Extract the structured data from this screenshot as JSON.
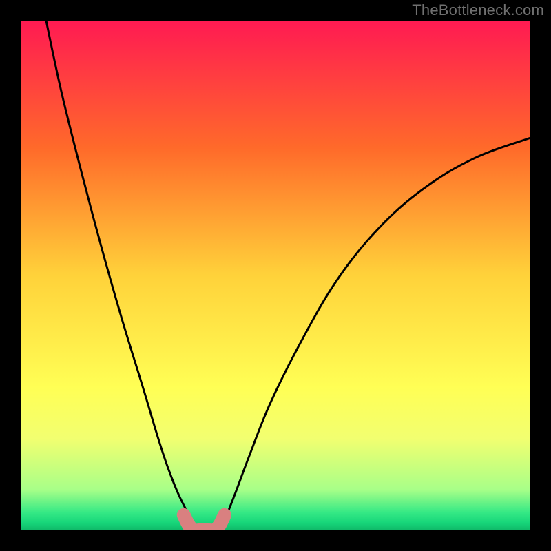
{
  "watermark": "TheBottleneck.com",
  "chart_data": {
    "type": "line",
    "title": "",
    "xlabel": "",
    "ylabel": "",
    "xlim": [
      0,
      100
    ],
    "ylim": [
      0,
      100
    ],
    "grid": false,
    "legend": false,
    "background_gradient": {
      "stops": [
        {
          "offset": 0.0,
          "color": "#ff1a52"
        },
        {
          "offset": 0.25,
          "color": "#ff6a2a"
        },
        {
          "offset": 0.5,
          "color": "#ffd23a"
        },
        {
          "offset": 0.72,
          "color": "#ffff55"
        },
        {
          "offset": 0.82,
          "color": "#f2ff70"
        },
        {
          "offset": 0.92,
          "color": "#a8ff88"
        },
        {
          "offset": 0.965,
          "color": "#35e985"
        },
        {
          "offset": 0.985,
          "color": "#17d67a"
        },
        {
          "offset": 1.0,
          "color": "#0fb868"
        }
      ]
    },
    "series": [
      {
        "name": "left-curve",
        "x": [
          5,
          8,
          12,
          16,
          20,
          24,
          27,
          29,
          31,
          33,
          34,
          35
        ],
        "y": [
          100,
          86,
          70,
          55,
          41,
          28,
          18,
          12,
          7,
          3,
          1,
          0
        ]
      },
      {
        "name": "right-curve",
        "x": [
          39,
          40,
          42,
          45,
          49,
          55,
          62,
          70,
          79,
          89,
          100
        ],
        "y": [
          0,
          2,
          7,
          15,
          25,
          37,
          49,
          59,
          67,
          73,
          77
        ]
      },
      {
        "name": "valley-marker",
        "x": [
          32,
          33,
          34,
          35,
          36,
          37,
          38,
          39,
          40
        ],
        "y": [
          3,
          1,
          0,
          0,
          0,
          0,
          0,
          1,
          3
        ],
        "style": "thick-rose"
      }
    ]
  }
}
